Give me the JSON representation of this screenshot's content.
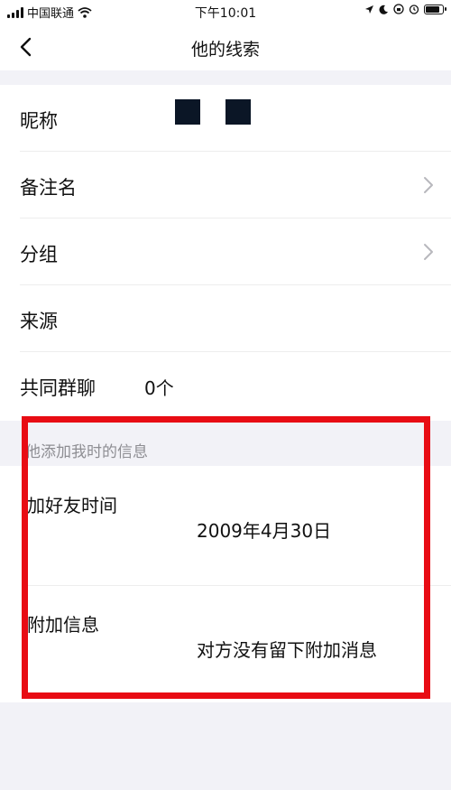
{
  "status_bar": {
    "carrier": "中国联通",
    "time": "下午10:01",
    "battery_level": 0.9
  },
  "nav": {
    "title": "他的线索",
    "back_icon": "chevron-left-icon"
  },
  "rows": [
    {
      "label": "昵称",
      "value_masked": true
    },
    {
      "label": "备注名",
      "chevron": true
    },
    {
      "label": "分组",
      "chevron": true
    },
    {
      "label": "来源"
    },
    {
      "label": "共同群聊",
      "value": "0个"
    }
  ],
  "add_info": {
    "section_header": "他添加我时的信息",
    "items": [
      {
        "label": "加好友时间",
        "value": "2009年4月30日"
      },
      {
        "label": "附加信息",
        "value": "对方没有留下附加消息"
      }
    ]
  },
  "colors": {
    "highlight": "#e80c14",
    "background": "#f2f2f7",
    "secondary_text": "#8e8e93"
  }
}
